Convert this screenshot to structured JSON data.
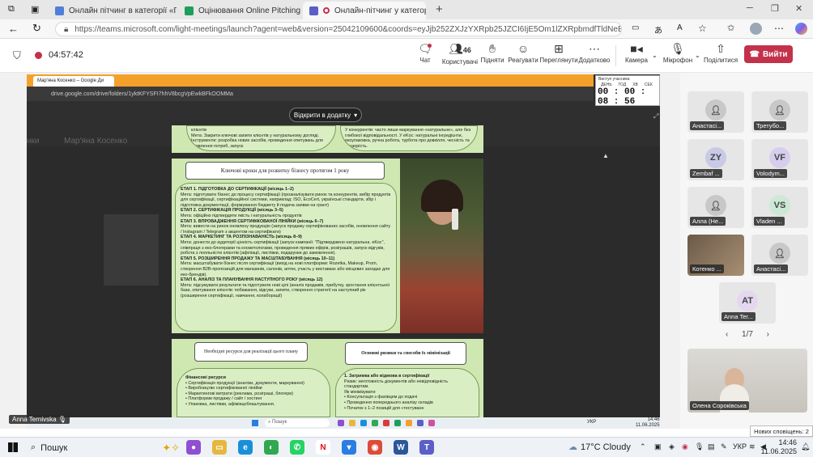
{
  "browser": {
    "tabs": [
      {
        "title": "Онлайн пітчинг в категорії «По»"
      },
      {
        "title": "Оцінювання Online Pitching - Go"
      },
      {
        "title": "Онлайн-пітчинг у категорі"
      }
    ],
    "url": "https://teams.microsoft.com/light-meetings/launch?agent=web&version=25042109600&coords=eyJjb252ZXJzYXRpb25JZCI6IjE5Om1lZXRpbmdfTldNeE9UbGxOaWRt"
  },
  "meeting": {
    "elapsed": "04:57:42",
    "toolbar": {
      "chat": "Чат",
      "people": "Користувачі",
      "people_count": "46",
      "raise": "Підняти",
      "react": "Реагувати",
      "view": "Переглянути",
      "more": "Додатково",
      "camera": "Камера",
      "mic": "Мікрофон",
      "share": "Поділитися",
      "leave": "Вийти"
    }
  },
  "shared_screen": {
    "drive_tab": "Мар'яна Косенко – Google Ди",
    "drive_url": "drive.google.com/drive/folders/1yktKFYSFI7hhV8bcgVpEwkBFkOOMMa",
    "open_in_app": "Відкрити в додатку",
    "timer": {
      "label": "Виступ учасника",
      "day": "ДЕНЬ",
      "hour": "ГОД",
      "min": "ХВ",
      "sec": "СЕК",
      "value": "00 : 00 : 08 : 56"
    },
    "ghost_title": "Мар'яна Косенко",
    "ghost_title_prefix": "нки",
    "doc": {
      "top_left": "клієнтів\nМета: Закрити ключові запити клієнтів у натуральному догляді. Інструменти: розробка нових засобів, проведення опитувань для виявлення потреб, запуск",
      "top_right": "У конкурентів: часто лише маркування «натуральне», але без глибокої відповідальності. У eKoc: натуральні інгредієнти, екоупаковка, ручна робота, турбота про довкілля, чесність та прозорість.",
      "steps_title": "Ключові кроки для розвитку бізнесу протягом 1 року",
      "steps": [
        {
          "h": "ЕТАП 1. ПІДГОТОВКА ДО СЕРТИФІКАЦІЇ (місяць 1–2)",
          "t": "Мета: підготувати бізнес до процесу сертифікації (проаналізувати ринок та конкурентів, вибір продуктів для сертифікації, сертифікаційної системи, наприклад: ISO, EcoCert, українські стандарти, збір і підготовка документації, формування бюджету й подача заявки на грант)"
        },
        {
          "h": "ЕТАП 2. СЕРТИФІКАЦІЯ ПРОДУКЦІЇ (місяць 3–5)",
          "t": "Мета: офіційно підтвердити якість і натуральність продуктів"
        },
        {
          "h": "ЕТАП 3. ВПРОВАДЖЕННЯ СЕРТИФІКОВАНОЇ ЛІНІЙКИ (місяць 6–7)",
          "t": "Мета: вивести на ринок оновлену продукцію (запуск продажу сертифікованих засобів, оновлення сайту / Instagram / Telegram з акцентом на сертифікати)"
        },
        {
          "h": "ЕТАП 4. МАРКЕТИНГ ТА РОЗПІЗНАВАНІСТЬ (місяць 8–9)",
          "t": "Мета: донести до аудиторії цінність сертифікації (запуск кампанії: \"Підтверджено натуральна. eKoc\", співпраця з еко-блогерами та косметологами, проведення прямих ефірів, розіграшів, запуск відгуків, робота з лояльністю клієнтів (афіліації, листівки, подарунки до замовлення)."
        },
        {
          "h": "ЕТАП 5. РОЗШИРЕННЯ ПРОДАЖУ ТА МАСШТАБУВАННЯ (місяць 10–11)",
          "t": "Мета: масштабувати бізнес після сертифікації (вихід на нові платформи: Rozetka, Makeup, Prom, створення B2B-пропозицій для магазинів, салонів, аптек, участь у виставках або місцевих заходах для еко-брендів)."
        },
        {
          "h": "ЕТАП 6. АНАЛІЗ ТА ПЛАНУВАННЯ НАСТУПНОГО РОКУ (місяць 12)",
          "t": "Мета: підсумувати результати та підготувати нові цілі (аналіз продажів, прибутку, зростання клієнтської бази, опитування клієнтів: побажання, відгуки, запити, створення стратегії на наступний рік (розширення сертифікації, навчання, колаборації)"
        }
      ],
      "resources_title": "Необхідні ресурси для реалізації цього плану",
      "risks_title": "Основні ризики та способи їх мінімізації",
      "resources": {
        "h": "Фінансові ресурси",
        "items": [
          "Сертифікація продукції (аналізи, документи, маркування)",
          "Виробництво сертифікованої лінійки",
          "Маркетингові витрати (реклама, розіграші, блогери)",
          "Платформи продажу / сайт / хостинг",
          "Упаковка, листівки, афіміацоблаштування."
        ]
      },
      "risks": {
        "h": "1. Затримка або відмова в сертифікації",
        "t": "Ризик: неготовність документів або невідповідність стандартам.",
        "sub": "Як мінімізувати:",
        "items": [
          "Консультація з фахівцем до подачі",
          "Проведення попереднього аналізу складів",
          "Початок з 1–2 позицій для «тестуванн"
        ]
      }
    },
    "presenter_name": "Anna Ternivska",
    "inner_search": "Пошук",
    "inner_lang": "УКР",
    "inner_time": "14:46",
    "inner_date": "11.06.2025"
  },
  "participants": [
    {
      "name": "Анастасі...",
      "initials": "",
      "kind": "silhouette"
    },
    {
      "name": "Третубо...",
      "initials": "",
      "kind": "silhouette"
    },
    {
      "name": "Zembaf ...",
      "initials": "ZY",
      "kind": "initials",
      "color": "#c9c9e8"
    },
    {
      "name": "Volodym...",
      "initials": "VF",
      "kind": "initials",
      "color": "#d7cdee"
    },
    {
      "name": "Алла (Не...",
      "initials": "",
      "kind": "silhouette"
    },
    {
      "name": "Vladen ...",
      "initials": "VS",
      "kind": "initials",
      "color": "#cde8d6"
    },
    {
      "name": "Котенко ...",
      "initials": "",
      "kind": "photo"
    },
    {
      "name": "Анастасі...",
      "initials": "",
      "kind": "silhouette"
    },
    {
      "name": "Anna Ter...",
      "initials": "AT",
      "kind": "initials",
      "color": "#e4d7ef"
    }
  ],
  "pagination": "1/7",
  "self_view_name": "Олена Сороківська",
  "toast": "Нових сповіщень: 2",
  "taskbar": {
    "search": "Пошук",
    "weather": "17°C  Cloudy",
    "lang": "УКР",
    "time": "14:46",
    "date": "11.06.2025"
  },
  "colors": {
    "teams_accent": "#5b5fc7",
    "leave_red": "#c4314b",
    "doc_green": "#cfe8b2",
    "drive_orange": "#f3a12b"
  }
}
